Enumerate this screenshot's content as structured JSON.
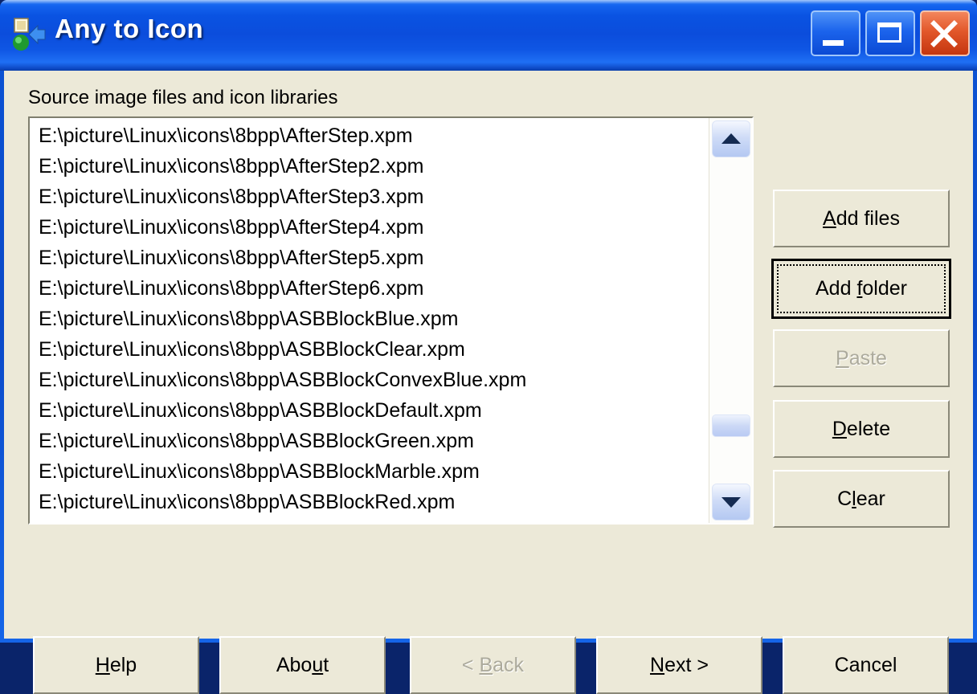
{
  "window": {
    "title": "Any to Icon",
    "app_icon": "any-to-icon-app-icon",
    "caption_buttons": {
      "minimize": "Minimize",
      "maximize": "Maximize",
      "close": "Close"
    },
    "colors": {
      "titlebar_blue": "#0b4ddc",
      "client_background": "#ece9d8",
      "close_button": "#e2572a",
      "listbox_background": "#ffffff",
      "scrollbar_thumb": "#ccd9f6",
      "disabled_text": "#acaa9c"
    }
  },
  "main": {
    "section_label": "Source image files and icon libraries",
    "file_list": [
      "E:\\picture\\Linux\\icons\\8bpp\\AfterStep.xpm",
      "E:\\picture\\Linux\\icons\\8bpp\\AfterStep2.xpm",
      "E:\\picture\\Linux\\icons\\8bpp\\AfterStep3.xpm",
      "E:\\picture\\Linux\\icons\\8bpp\\AfterStep4.xpm",
      "E:\\picture\\Linux\\icons\\8bpp\\AfterStep5.xpm",
      "E:\\picture\\Linux\\icons\\8bpp\\AfterStep6.xpm",
      "E:\\picture\\Linux\\icons\\8bpp\\ASBBlockBlue.xpm",
      "E:\\picture\\Linux\\icons\\8bpp\\ASBBlockClear.xpm",
      "E:\\picture\\Linux\\icons\\8bpp\\ASBBlockConvexBlue.xpm",
      "E:\\picture\\Linux\\icons\\8bpp\\ASBBlockDefault.xpm",
      "E:\\picture\\Linux\\icons\\8bpp\\ASBBlockGreen.xpm",
      "E:\\picture\\Linux\\icons\\8bpp\\ASBBlockMarble.xpm",
      "E:\\picture\\Linux\\icons\\8bpp\\ASBBlockRed.xpm"
    ],
    "scrollbar": {
      "up_arrow": "scroll-up-icon",
      "down_arrow": "scroll-down-icon"
    }
  },
  "side_buttons": {
    "add_files": {
      "label": "Add files",
      "accel": "A",
      "state": "enabled"
    },
    "add_folder": {
      "label": "Add folder",
      "accel": "f",
      "state": "focused"
    },
    "paste": {
      "label": "Paste",
      "accel": "P",
      "state": "disabled"
    },
    "delete": {
      "label": "Delete",
      "accel": "D",
      "state": "enabled"
    },
    "clear": {
      "label": "Clear",
      "accel": "l",
      "state": "enabled"
    }
  },
  "bottom_buttons": {
    "help": {
      "label": "Help",
      "accel": "H",
      "state": "enabled"
    },
    "about": {
      "label": "About",
      "accel": "u",
      "state": "enabled"
    },
    "back": {
      "label": "< Back",
      "accel": "B",
      "state": "disabled"
    },
    "next": {
      "label": "Next >",
      "accel": "N",
      "state": "enabled"
    },
    "cancel": {
      "label": "Cancel",
      "accel": "",
      "state": "enabled"
    }
  }
}
